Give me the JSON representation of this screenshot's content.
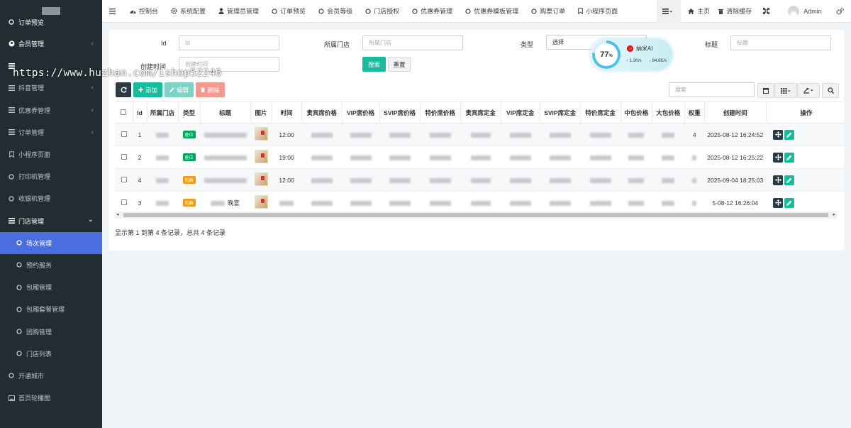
{
  "sidebar": {
    "items": [
      {
        "label": "订单预览",
        "icon": "circle-icon"
      },
      {
        "label": "会员管理",
        "icon": "user-icon",
        "arrow": "‹"
      },
      {
        "label": "",
        "icon": "list-icon"
      },
      {
        "label": "抖音管理",
        "icon": "list-icon",
        "arrow": "‹"
      },
      {
        "label": "优惠券管理",
        "icon": "list-icon",
        "arrow": "‹"
      },
      {
        "label": "订单管理",
        "icon": "list-icon",
        "arrow": "‹"
      },
      {
        "label": "小程序页面",
        "icon": "bookmark-icon"
      },
      {
        "label": "打印机管理",
        "icon": "circle-icon"
      },
      {
        "label": "收银机管理",
        "icon": "circle-icon"
      },
      {
        "label": "门店管理",
        "icon": "list-icon",
        "arrow": "⌄"
      },
      {
        "label": "场次管理",
        "icon": "circle-icon"
      },
      {
        "label": "预约服务",
        "icon": "circle-icon"
      },
      {
        "label": "包厢管理",
        "icon": "circle-icon"
      },
      {
        "label": "包厢套餐管理",
        "icon": "circle-icon"
      },
      {
        "label": "团购管理",
        "icon": "circle-icon"
      },
      {
        "label": "门店列表",
        "icon": "circle-icon"
      },
      {
        "label": "开通城市",
        "icon": "circle-icon"
      },
      {
        "label": "首页轮播图",
        "icon": "image-icon"
      }
    ]
  },
  "watermark": "https://www.huzhan.com/ishop52246",
  "topbar": {
    "items": [
      "控制台",
      "系统配置",
      "管理员管理",
      "订单预览",
      "会员等级",
      "门店授权",
      "优惠券管理",
      "优惠券模板管理",
      "购票订单",
      "小程序页面"
    ],
    "home": "主页",
    "clear_cache": "清除缓存",
    "user": "Admin"
  },
  "form": {
    "id_label": "Id",
    "id_placeholder": "Id",
    "store_label": "所属门店",
    "store_placeholder": "所属门店",
    "type_label": "类型",
    "type_value": "选择",
    "title_label": "标题",
    "title_placeholder": "标题",
    "created_label": "创建时间",
    "created_placeholder": "创建时间",
    "search_button": "搜索",
    "reset_button": "重置"
  },
  "ai_widget": {
    "percent": "77",
    "unit": "%",
    "name": "纳米AI",
    "up": "1.2K/s",
    "down": "84.6K/s"
  },
  "toolbar": {
    "add": "添加",
    "edit": "编辑",
    "delete": "删除",
    "search_placeholder": "搜索"
  },
  "table": {
    "headers": [
      "Id",
      "所属门店",
      "类型",
      "标题",
      "图片",
      "时间",
      "贵宾席价格",
      "VIP席价格",
      "SVIP席价格",
      "特价席价格",
      "贵宾席定金",
      "VIP席定金",
      "SVIP席定金",
      "特价席定金",
      "中包价格",
      "大包价格",
      "权重",
      "创建时间",
      "操作"
    ],
    "rows": [
      {
        "id": "1",
        "type": "座位",
        "type_color": "#00a65a",
        "time": "12:00",
        "weight": "4",
        "created": "2025-08-12 16:24:52",
        "title_suffix": ""
      },
      {
        "id": "2",
        "type": "座位",
        "type_color": "#00a65a",
        "time": "19:00",
        "weight": "",
        "created": "2025-08-12 16:25:22",
        "title_suffix": ""
      },
      {
        "id": "4",
        "type": "包厢",
        "type_color": "#f39c12",
        "time": "12:00",
        "weight": "",
        "created": "2025-09-04 18:25:03",
        "title_suffix": ""
      },
      {
        "id": "3",
        "type": "包厢",
        "type_color": "#f39c12",
        "time": "",
        "weight": "",
        "created": "5-08-12 16:26:04",
        "title_suffix": "晚宴"
      }
    ]
  },
  "footer": "显示第 1 到第 4 条记录，总共 4 条记录",
  "colors": {
    "sidebar_bg": "#222d32",
    "active": "#4a6de0",
    "success": "#18bc9c",
    "info": "#3c8dbc",
    "danger": "#e74c3c",
    "dark_btn": "#2c3b41"
  }
}
